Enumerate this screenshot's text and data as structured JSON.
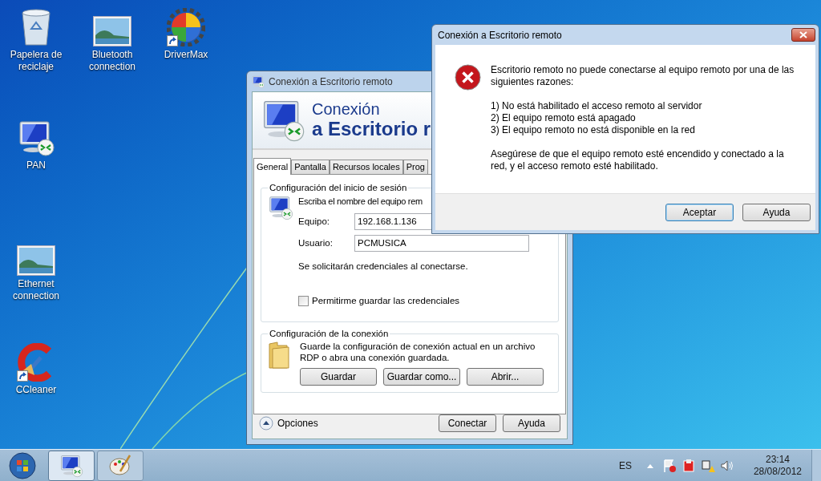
{
  "desktop_icons": [
    {
      "label": "Papelera de reciclaje",
      "kind": "recycle-bin",
      "shortcut": false
    },
    {
      "label": "Bluetooth connection",
      "kind": "picture",
      "shortcut": false
    },
    {
      "label": "DriverMax",
      "kind": "gear",
      "shortcut": true
    },
    {
      "label": "PAN",
      "kind": "remote",
      "shortcut": false
    },
    {
      "label": "Ethernet connection",
      "kind": "picture",
      "shortcut": false
    },
    {
      "label": "CCleaner",
      "kind": "cleaner",
      "shortcut": true
    }
  ],
  "main_window": {
    "title": "Conexión a Escritorio remoto",
    "header_line1": "Conexión",
    "header_line2": "a Escritorio r",
    "tabs": [
      {
        "label": "General",
        "selected": true
      },
      {
        "label": "Pantalla",
        "selected": false
      },
      {
        "label": "Recursos locales",
        "selected": false
      },
      {
        "label": "Prog",
        "selected": false
      }
    ],
    "logon_group": {
      "legend": "Configuración del inicio de sesión",
      "instruction": "Escriba el nombre del equipo rem",
      "fields": [
        {
          "label": "Equipo:",
          "value": "192.168.1.136"
        },
        {
          "label": "Usuario:",
          "value": "PCMUSICA"
        }
      ],
      "note": "Se solicitarán credenciales al conectarse.",
      "checkbox": {
        "label": "Permitirme guardar las credenciales",
        "checked": false
      }
    },
    "connection_group": {
      "legend": "Configuración de la conexión",
      "text": "Guarde la configuración de conexión actual en un archivo RDP o abra una conexión guardada.",
      "buttons": [
        "Guardar",
        "Guardar como...",
        "Abrir..."
      ]
    },
    "options_label": "Opciones",
    "buttons": [
      "Conectar",
      "Ayuda"
    ]
  },
  "error_dialog": {
    "title": "Conexión a Escritorio remoto",
    "intro": "Escritorio remoto no puede conectarse al equipo remoto por una de las siguientes razones:",
    "reasons": [
      "1) No está habilitado el acceso remoto al servidor",
      "2) El equipo remoto está apagado",
      "3) El equipo remoto no está disponible en la red"
    ],
    "advice": "Asegúrese de que el equipo remoto esté encendido y conectado a la red, y el acceso remoto esté habilitado.",
    "buttons": [
      {
        "label": "Aceptar",
        "default": true
      },
      {
        "label": "Ayuda",
        "default": false
      }
    ]
  },
  "taskbar": {
    "items": [
      {
        "kind": "remote",
        "active": true
      },
      {
        "kind": "paint",
        "active": false
      }
    ],
    "language": "ES",
    "time": "23:14",
    "date": "28/08/2012"
  }
}
